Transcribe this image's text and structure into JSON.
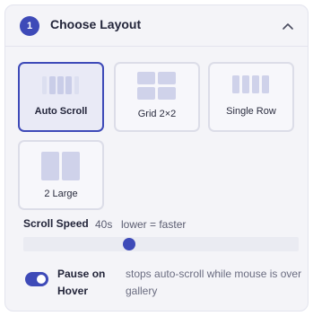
{
  "header": {
    "step_number": "1",
    "title": "Choose Layout"
  },
  "layouts": [
    {
      "label": "Auto Scroll",
      "selected": true,
      "icon": "auto-scroll-layout-icon"
    },
    {
      "label": "Grid 2×2",
      "selected": false,
      "icon": "grid-layout-icon"
    },
    {
      "label": "Single Row",
      "selected": false,
      "icon": "single-row-layout-icon"
    },
    {
      "label": "2 Large",
      "selected": false,
      "icon": "two-large-layout-icon"
    }
  ],
  "scroll_speed": {
    "label": "Scroll Speed",
    "value": "40s",
    "hint": "lower = faster",
    "slider_fraction": 0.38
  },
  "pause_on_hover": {
    "label": "Pause on Hover",
    "enabled": true,
    "description": "stops auto-scroll while mouse is over gallery"
  },
  "colors": {
    "accent": "#3e4ab8",
    "panel_bg": "#f4f4f8",
    "thumb_light": "#dcdff0",
    "thumb_mid": "#cfd2ea"
  }
}
